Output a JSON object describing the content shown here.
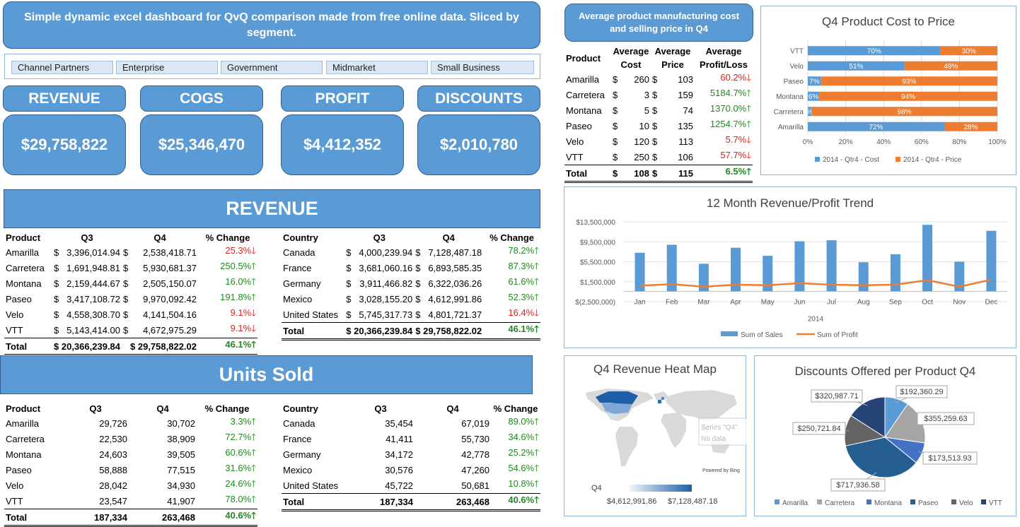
{
  "header": {
    "title": "Simple dynamic excel dashboard for QvQ comparison made from free online data. Sliced by segment."
  },
  "slicer": [
    "Channel Partners",
    "Enterprise",
    "Government",
    "Midmarket",
    "Small Business"
  ],
  "kpi": [
    {
      "label": "REVENUE",
      "value": "$29,758,822"
    },
    {
      "label": "COGS",
      "value": "$25,346,470"
    },
    {
      "label": "PROFIT",
      "value": "$4,412,352"
    },
    {
      "label": "DISCOUNTS",
      "value": "$2,010,780"
    }
  ],
  "avgcost": {
    "title": "Average product manufacturing cost and selling price in Q4",
    "headers": [
      "Product",
      "Average Cost",
      "Average Price",
      "Average Profit/Loss"
    ],
    "rows": [
      {
        "p": "Amarilla",
        "cs": "$",
        "c": "260",
        "ps": "$",
        "pr": "103",
        "pl": "60.2%",
        "dir": "down"
      },
      {
        "p": "Carretera",
        "cs": "$",
        "c": "3",
        "ps": "$",
        "pr": "159",
        "pl": "5184.7%",
        "dir": "up"
      },
      {
        "p": "Montana",
        "cs": "$",
        "c": "5",
        "ps": "$",
        "pr": "74",
        "pl": "1370.0%",
        "dir": "up"
      },
      {
        "p": "Paseo",
        "cs": "$",
        "c": "10",
        "ps": "$",
        "pr": "135",
        "pl": "1254.7%",
        "dir": "up"
      },
      {
        "p": "Velo",
        "cs": "$",
        "c": "120",
        "ps": "$",
        "pr": "113",
        "pl": "5.7%",
        "dir": "down"
      },
      {
        "p": "VTT",
        "cs": "$",
        "c": "250",
        "ps": "$",
        "pr": "106",
        "pl": "57.7%",
        "dir": "down"
      }
    ],
    "total": {
      "p": "Total",
      "cs": "$",
      "c": "108",
      "ps": "$",
      "pr": "115",
      "pl": "6.5%",
      "dir": "up"
    }
  },
  "arrows": {
    "up": "🡑",
    "down": "🡓"
  },
  "revenue": {
    "band": "REVENUE",
    "product": {
      "headers": [
        "Product",
        "Q3",
        "Q4",
        "% Change"
      ],
      "rows": [
        {
          "n": "Amarilla",
          "q3": "3,396,014.94",
          "q4": "2,538,418.71",
          "pc": "25.3%",
          "dir": "down"
        },
        {
          "n": "Carretera",
          "q3": "1,691,948.81",
          "q4": "5,930,681.37",
          "pc": "250.5%",
          "dir": "up"
        },
        {
          "n": "Montana",
          "q3": "2,159,444.67",
          "q4": "2,505,150.07",
          "pc": "16.0%",
          "dir": "up"
        },
        {
          "n": "Paseo",
          "q3": "3,417,108.72",
          "q4": "9,970,092.42",
          "pc": "191.8%",
          "dir": "up"
        },
        {
          "n": "Velo",
          "q3": "4,558,308.70",
          "q4": "4,141,504.16",
          "pc": "9.1%",
          "dir": "down"
        },
        {
          "n": "VTT",
          "q3": "5,143,414.00",
          "q4": "4,672,975.29",
          "pc": "9.1%",
          "dir": "down"
        }
      ],
      "total": {
        "n": "Total",
        "q3": "$ 20,366,239.84",
        "q4": "$ 29,758,822.02",
        "pc": "46.1%",
        "dir": "up"
      }
    },
    "country": {
      "headers": [
        "Country",
        "Q3",
        "Q4",
        "% Change"
      ],
      "rows": [
        {
          "n": "Canada",
          "q3": "4,000,239.94",
          "q4": "7,128,487.18",
          "pc": "78.2%",
          "dir": "up"
        },
        {
          "n": "France",
          "q3": "3,681,060.16",
          "q4": "6,893,585.35",
          "pc": "87.3%",
          "dir": "up"
        },
        {
          "n": "Germany",
          "q3": "3,911,466.82",
          "q4": "6,322,036.26",
          "pc": "61.6%",
          "dir": "up"
        },
        {
          "n": "Mexico",
          "q3": "3,028,155.20",
          "q4": "4,612,991.86",
          "pc": "52.3%",
          "dir": "up"
        },
        {
          "n": "United States",
          "q3": "5,745,317.73",
          "q4": "4,801,721.37",
          "pc": "16.4%",
          "dir": "down"
        }
      ],
      "total": {
        "n": "Total",
        "q3": "$ 20,366,239.84",
        "q4": "$ 29,758,822.02",
        "pc": "46.1%",
        "dir": "up"
      }
    }
  },
  "units": {
    "band": "Units Sold",
    "product": {
      "headers": [
        "Product",
        "Q3",
        "Q4",
        "% Change"
      ],
      "rows": [
        {
          "n": "Amarilla",
          "q3": "29,726",
          "q4": "30,702",
          "pc": "3.3%",
          "dir": "up"
        },
        {
          "n": "Carretera",
          "q3": "22,530",
          "q4": "38,909",
          "pc": "72.7%",
          "dir": "up"
        },
        {
          "n": "Montana",
          "q3": "24,603",
          "q4": "39,505",
          "pc": "60.6%",
          "dir": "up"
        },
        {
          "n": "Paseo",
          "q3": "58,888",
          "q4": "77,515",
          "pc": "31.6%",
          "dir": "up"
        },
        {
          "n": "Velo",
          "q3": "28,042",
          "q4": "34,930",
          "pc": "24.6%",
          "dir": "up"
        },
        {
          "n": "VTT",
          "q3": "23,547",
          "q4": "41,907",
          "pc": "78.0%",
          "dir": "up"
        }
      ],
      "total": {
        "n": "Total",
        "q3": "187,334",
        "q4": "263,468",
        "pc": "40.6%",
        "dir": "up"
      }
    },
    "country": {
      "headers": [
        "Country",
        "Q3",
        "Q4",
        "% Change"
      ],
      "rows": [
        {
          "n": "Canada",
          "q3": "35,454",
          "q4": "67,019",
          "pc": "89.0%",
          "dir": "up"
        },
        {
          "n": "France",
          "q3": "41,411",
          "q4": "55,730",
          "pc": "34.6%",
          "dir": "up"
        },
        {
          "n": "Germany",
          "q3": "34,172",
          "q4": "42,778",
          "pc": "25.2%",
          "dir": "up"
        },
        {
          "n": "Mexico",
          "q3": "30,576",
          "q4": "47,260",
          "pc": "54.6%",
          "dir": "up"
        },
        {
          "n": "United States",
          "q3": "45,722",
          "q4": "50,681",
          "pc": "10.8%",
          "dir": "up"
        }
      ],
      "total": {
        "n": "Total",
        "q3": "187,334",
        "q4": "263,468",
        "pc": "40.6%",
        "dir": "up"
      }
    }
  },
  "currency_symbol": "$",
  "heatmap": {
    "title": "Q4 Revenue Heat Map",
    "series_label": "Series \"Q4\"",
    "nodata": "No data",
    "powered": "Powered by Bing",
    "legend_label": "Q4",
    "min": "$4,612,991.86",
    "max": "$7,128,487.18"
  },
  "colors": {
    "blue": "#5b9bd5",
    "orange": "#ed7d31",
    "up": "#1e8a1e",
    "down": "#e02020"
  },
  "chart_data": [
    {
      "type": "bar",
      "orientation": "horizontal",
      "stacked": "100%",
      "title": "Q4 Product Cost to Price",
      "categories": [
        "VTT",
        "Velo",
        "Paseo",
        "Montana",
        "Carretera",
        "Amarilla"
      ],
      "series": [
        {
          "name": "2014 - Qtr4 - Cost",
          "values": [
            70,
            51,
            7,
            6,
            2,
            72
          ],
          "labels": [
            "70%",
            "51%",
            "7%",
            "6%",
            "%",
            "72%"
          ]
        },
        {
          "name": "2014 - Qtr4 - Price",
          "values": [
            30,
            49,
            93,
            94,
            98,
            28
          ],
          "labels": [
            "30%",
            "49%",
            "93%",
            "94%",
            "98%",
            "28%"
          ]
        }
      ],
      "xticks": [
        "0%",
        "20%",
        "40%",
        "60%",
        "80%",
        "100%"
      ],
      "xlim": [
        0,
        100
      ],
      "legend": "bottom"
    },
    {
      "type": "bar+line",
      "title": "12 Month Revenue/Profit Trend",
      "categories": [
        "Jan",
        "Feb",
        "Mar",
        "Apr",
        "May",
        "Jun",
        "Jul",
        "Aug",
        "Sep",
        "Oct",
        "Nov",
        "Dec"
      ],
      "xlabel": "2014",
      "series": [
        {
          "name": "Sum of  Sales",
          "type": "bar",
          "values": [
            7300000,
            8900000,
            5100000,
            8300000,
            6700000,
            9600000,
            9800000,
            5400000,
            7000000,
            12900000,
            5500000,
            11700000
          ]
        },
        {
          "name": "Sum of Profit",
          "type": "line",
          "values": [
            700000,
            1000000,
            500000,
            900000,
            800000,
            1200000,
            900000,
            800000,
            900000,
            1800000,
            500000,
            1900000
          ]
        }
      ],
      "yticks": [
        "$13,500,000",
        "$9,500,000",
        "$5,500,000",
        "$1,500,000",
        "$(2,500,000)"
      ],
      "ylim": [
        -2500000,
        13500000
      ],
      "legend": "bottom"
    },
    {
      "type": "pie",
      "title": "Discounts Offered per Product Q4",
      "categories": [
        "Amarilla",
        "Carretera",
        "Montana",
        "Paseo",
        "Velo",
        "VTT"
      ],
      "values": [
        192360.29,
        355259.63,
        173513.93,
        717936.58,
        250721.84,
        320987.71
      ],
      "labels": [
        "$192,360.29",
        "$355,259.63",
        "$173,513.93",
        "$717,936.58",
        "$250,721.84",
        "$320,987.71"
      ],
      "colors": [
        "#5b9bd5",
        "#a5a5a5",
        "#4472c4",
        "#255e91",
        "#636363",
        "#264478"
      ],
      "legend": "bottom"
    }
  ]
}
